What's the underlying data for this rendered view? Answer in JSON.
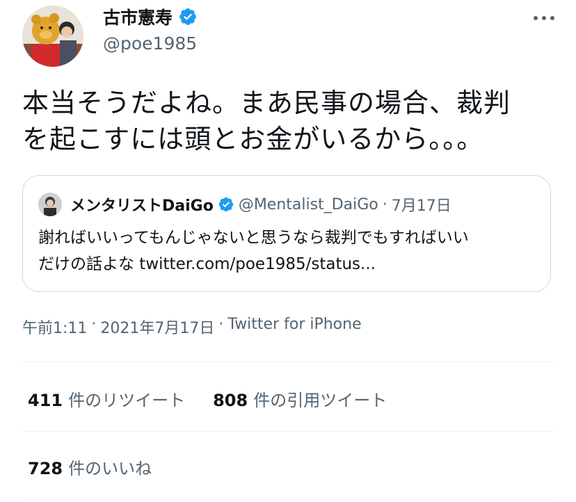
{
  "author": {
    "name": "古市憲寿",
    "handle": "@poe1985",
    "verified": true
  },
  "tweet": {
    "text": "本当そうだよね。まあ民事の場合、裁判\nを起こすには頭とお金がいるから。。。"
  },
  "quote": {
    "name": "メンタリストDaiGo",
    "handle": "@Mentalist_DaiGo",
    "separator": "·",
    "date": "7月17日",
    "text": "謝ればいいってもんじゃないと思うなら裁判でもすればいい\nだけの話よな twitter.com/poe1985/status..."
  },
  "meta": {
    "time": "午前1:11",
    "separator": "·",
    "date": "2021年7月17日",
    "source": "Twitter for iPhone"
  },
  "stats": {
    "retweets_count": "411",
    "retweets_label": "件のリツイート",
    "quotes_count": "808",
    "quotes_label": "件の引用ツイート",
    "likes_count": "728",
    "likes_label": "件のいいね"
  },
  "colors": {
    "verified_badge": "#1d9bf0",
    "secondary_text": "#536471",
    "border": "#cfd9de"
  },
  "icons": {
    "verified": "verified-badge-icon",
    "more": "more-horizontal-icon"
  }
}
